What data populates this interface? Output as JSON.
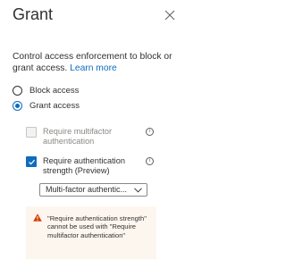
{
  "panel": {
    "title": "Grant"
  },
  "description": {
    "text": "Control access enforcement to block or grant access. ",
    "link": "Learn more"
  },
  "access_options": [
    {
      "label": "Block access",
      "selected": false
    },
    {
      "label": "Grant access",
      "selected": true
    }
  ],
  "controls": [
    {
      "label": "Require multifactor authentication",
      "checked": false,
      "disabled": true
    },
    {
      "label": "Require authentication strength (Preview)",
      "checked": true,
      "disabled": false
    }
  ],
  "strength_select": {
    "value": "Multi-factor authentic..."
  },
  "warning": {
    "text": "\"Require authentication strength\" cannot be used with \"Require multifactor authentication\""
  },
  "colors": {
    "accent": "#0f6cbd",
    "warning_bg": "#fdf6ef",
    "warning_icon": "#d83b01"
  },
  "icons": [
    "close-icon",
    "info-icon",
    "chevron-down-icon",
    "warning-icon",
    "checkmark-icon"
  ]
}
